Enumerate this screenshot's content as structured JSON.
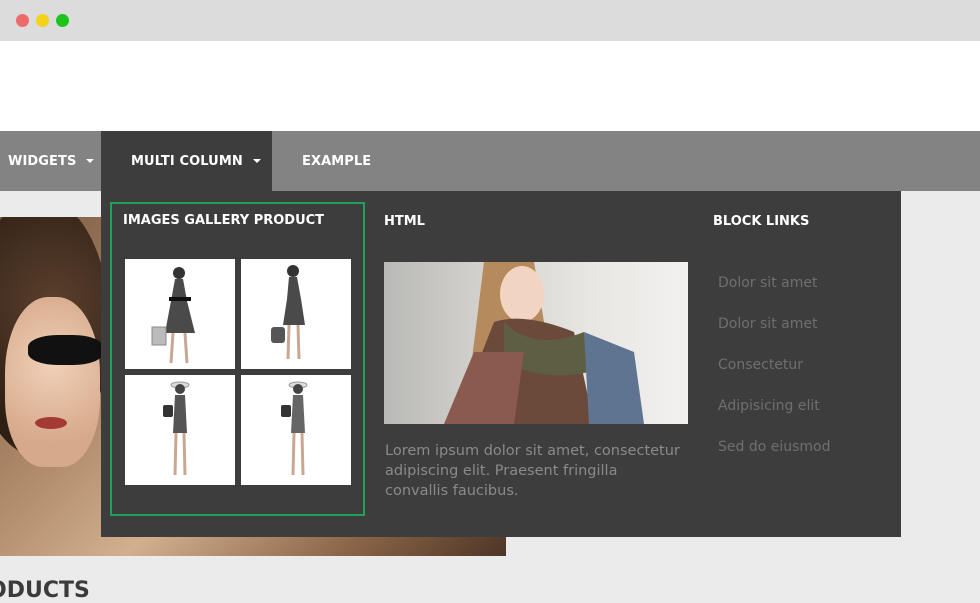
{
  "window": {
    "controls": [
      "close",
      "minimize",
      "maximize"
    ],
    "colors": {
      "close": "#ef6b6b",
      "minimize": "#f3d21b",
      "maximize": "#1ec31e"
    }
  },
  "nav": {
    "items": [
      {
        "label": "WIDGETS",
        "has_dropdown": true
      },
      {
        "label": "MULTI COLUMN",
        "has_dropdown": true,
        "active": true
      },
      {
        "label": "EXAMPLE",
        "has_dropdown": false
      }
    ],
    "bar_color": "#838383",
    "active_color": "#3d3d3d"
  },
  "mega_menu": {
    "gallery": {
      "title": "IMAGES GALLERY PRODUCT",
      "highlight_color": "#1ea25b",
      "images": [
        "woman-floral-dress-with-bag",
        "woman-floral-dress-handbag",
        "woman-hat-outfit",
        "woman-hat-outfit-alt"
      ]
    },
    "html": {
      "title": "HTML",
      "image": "woman-with-scarf",
      "text": "Lorem ipsum dolor sit amet, consectetur adipiscing elit. Praesent fringilla convallis faucibus."
    },
    "block_links": {
      "title": "BLOCK LINKS",
      "links": [
        "Dolor sit amet",
        "Dolor sit amet",
        "Consectetur",
        "Adipisicing elit",
        "Sed do eiusmod"
      ]
    }
  },
  "page": {
    "section_heading": "ODUCTS",
    "hero_image": "woman-sunglasses-photo"
  }
}
